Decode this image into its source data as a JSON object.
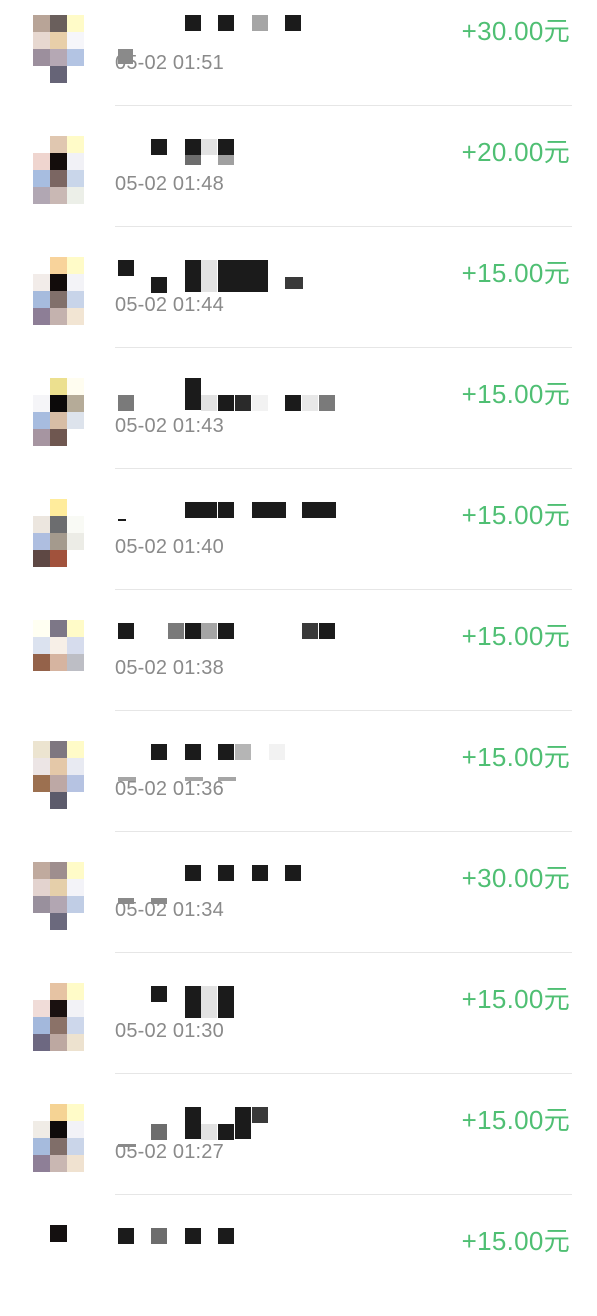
{
  "transactions": [
    {
      "amount": "+30.00元",
      "time": "05-02 01:51",
      "avatar": [
        "#b8a497",
        "#6a5f5c",
        "#fffbc8",
        "#e7d8d0",
        "#e8cfa9",
        "#f6f6fa",
        "#9c8f9d",
        "#b5a8b4",
        "#b3c4e3",
        "#ffffff",
        "#666477",
        "#ffffff"
      ]
    },
    {
      "amount": "+20.00元",
      "time": "05-02 01:48",
      "avatar": [
        "#ffffff",
        "#e0c7b0",
        "#fffbc8",
        "#efd5cf",
        "#140d0c",
        "#f1f1f6",
        "#a7bde0",
        "#7b6662",
        "#c9d6ea",
        "#b1a7b3",
        "#c9b8b4",
        "#ecefe8"
      ]
    },
    {
      "amount": "+15.00元",
      "time": "05-02 01:44",
      "avatar": [
        "#ffffff",
        "#f8d39b",
        "#fffbc8",
        "#f2ece9",
        "#120c0b",
        "#f3f3f7",
        "#a6bbdd",
        "#81706b",
        "#c8d4e9",
        "#8d7e96",
        "#c4b2ae",
        "#f2e5d3"
      ]
    },
    {
      "amount": "+15.00元",
      "time": "05-02 01:43",
      "avatar": [
        "#ffffff",
        "#ece08f",
        "#fffdf0",
        "#f5f5f8",
        "#0c0a0a",
        "#b5ab98",
        "#a7bcdf",
        "#d7bda5",
        "#dde3ec",
        "#a695a1",
        "#6f5750",
        "#ffffff"
      ]
    },
    {
      "amount": "+15.00元",
      "time": "05-02 01:40",
      "avatar": [
        "#ffffff",
        "#ffec9c",
        "#ffffff",
        "#ece6df",
        "#6c6d6f",
        "#f9faf5",
        "#aebee0",
        "#a49a8d",
        "#ecece6",
        "#5e4844",
        "#a1523c",
        "#ffffff"
      ]
    },
    {
      "amount": "+15.00元",
      "time": "05-02 01:38",
      "avatar": [
        "#fffff2",
        "#7d7787",
        "#fffbc8",
        "#dbe2ef",
        "#f7efe7",
        "#d6dced",
        "#94624a",
        "#d6b4a0",
        "#bdbec5",
        "#ffffff",
        "#ffffff",
        "#ffffff"
      ]
    },
    {
      "amount": "+15.00元",
      "time": "05-02 01:36",
      "avatar": [
        "#ece4d0",
        "#7e7780",
        "#fffbc8",
        "#ece5e5",
        "#e4c8a8",
        "#e8eaf2",
        "#9c7050",
        "#bda8a5",
        "#b6c3e2",
        "#ffffff",
        "#5c5b6b",
        "#ffffff"
      ]
    },
    {
      "amount": "+30.00元",
      "time": "05-02 01:34",
      "avatar": [
        "#c0aa9e",
        "#9e8e8e",
        "#fffbc8",
        "#e3d3cf",
        "#e5cfaa",
        "#f3f3f8",
        "#99909d",
        "#b2a6b2",
        "#c0cde5",
        "#ffffff",
        "#6b697d",
        "#ffffff"
      ]
    },
    {
      "amount": "+15.00元",
      "time": "05-02 01:30",
      "avatar": [
        "#ffffff",
        "#e6c3a3",
        "#fffbc8",
        "#f0dcd8",
        "#1a1110",
        "#f2f2f6",
        "#a3b8dc",
        "#8b7268",
        "#cdd7eb",
        "#6d6881",
        "#bda8a1",
        "#ede2cf"
      ]
    },
    {
      "amount": "+15.00元",
      "time": "05-02 01:27",
      "avatar": [
        "#ffffff",
        "#f5d394",
        "#fffbc8",
        "#f0ece6",
        "#0f0b0b",
        "#f2f2f7",
        "#a6bbdd",
        "#806e69",
        "#cad5e9",
        "#8e7f97",
        "#c9b7b2",
        "#f0e2d0"
      ]
    },
    {
      "amount": "+15.00元",
      "time": "",
      "avatar": [
        "#ffffff",
        "#141010",
        "#ffffff",
        "#ffffff",
        "#ffffff",
        "#ffffff",
        "#ffffff",
        "#ffffff",
        "#ffffff",
        "#ffffff",
        "#ffffff",
        "#ffffff"
      ]
    }
  ]
}
